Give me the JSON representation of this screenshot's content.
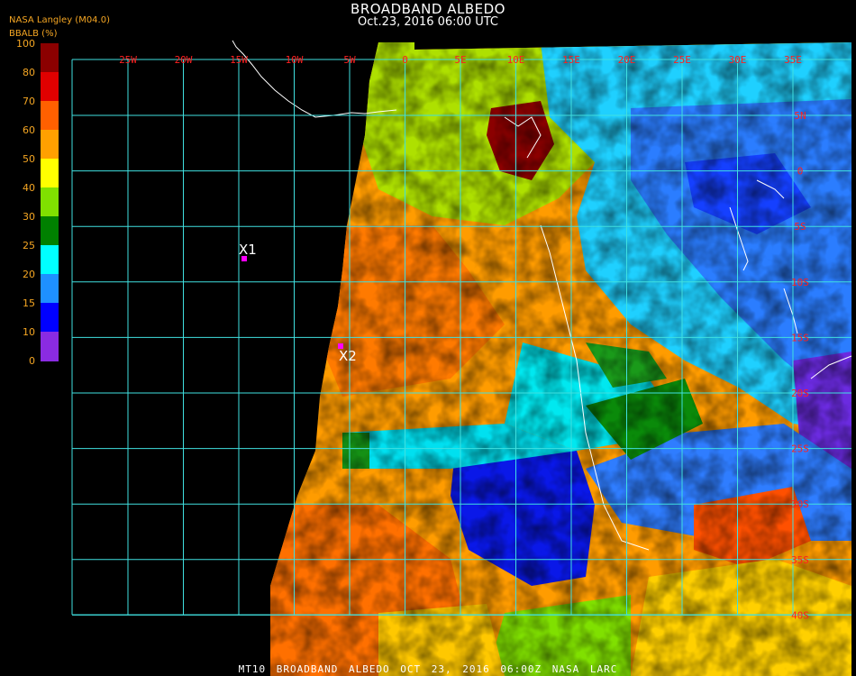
{
  "header": {
    "title": "BROADBAND ALBEDO",
    "subtitle": "Oct.23, 2016 06:00 UTC",
    "organization": "NASA Langley (M04.0)",
    "unit_label": "BBALB (%)"
  },
  "legend": {
    "ticks": [
      "100",
      "80",
      "70",
      "60",
      "50",
      "40",
      "30",
      "25",
      "20",
      "15",
      "10",
      "0"
    ],
    "colors": [
      "#8b0000",
      "#e00000",
      "#ff6000",
      "#ffa000",
      "#ffff00",
      "#80e000",
      "#008000",
      "#00ffff",
      "#1e90ff",
      "#0000ff",
      "#8a2be2"
    ]
  },
  "grid": {
    "lon_labels": [
      "25W",
      "20W",
      "15W",
      "10W",
      "5W",
      "0",
      "5E",
      "10E",
      "15E",
      "20E",
      "25E",
      "30E",
      "35E"
    ],
    "lat_labels": [
      "5N",
      "0",
      "5S",
      "10S",
      "15S",
      "20S",
      "25S",
      "30S",
      "35S",
      "40S"
    ],
    "line_color": "#40e0e0",
    "label_color": "#ff2020"
  },
  "markers": [
    {
      "label": "X1",
      "color": "#ff00ff"
    },
    {
      "label": "X2",
      "color": "#ff00ff"
    }
  ],
  "footer": "MT10  BROADBAND ALBEDO   OCT 23, 2016 06:00Z   NASA LARC"
}
